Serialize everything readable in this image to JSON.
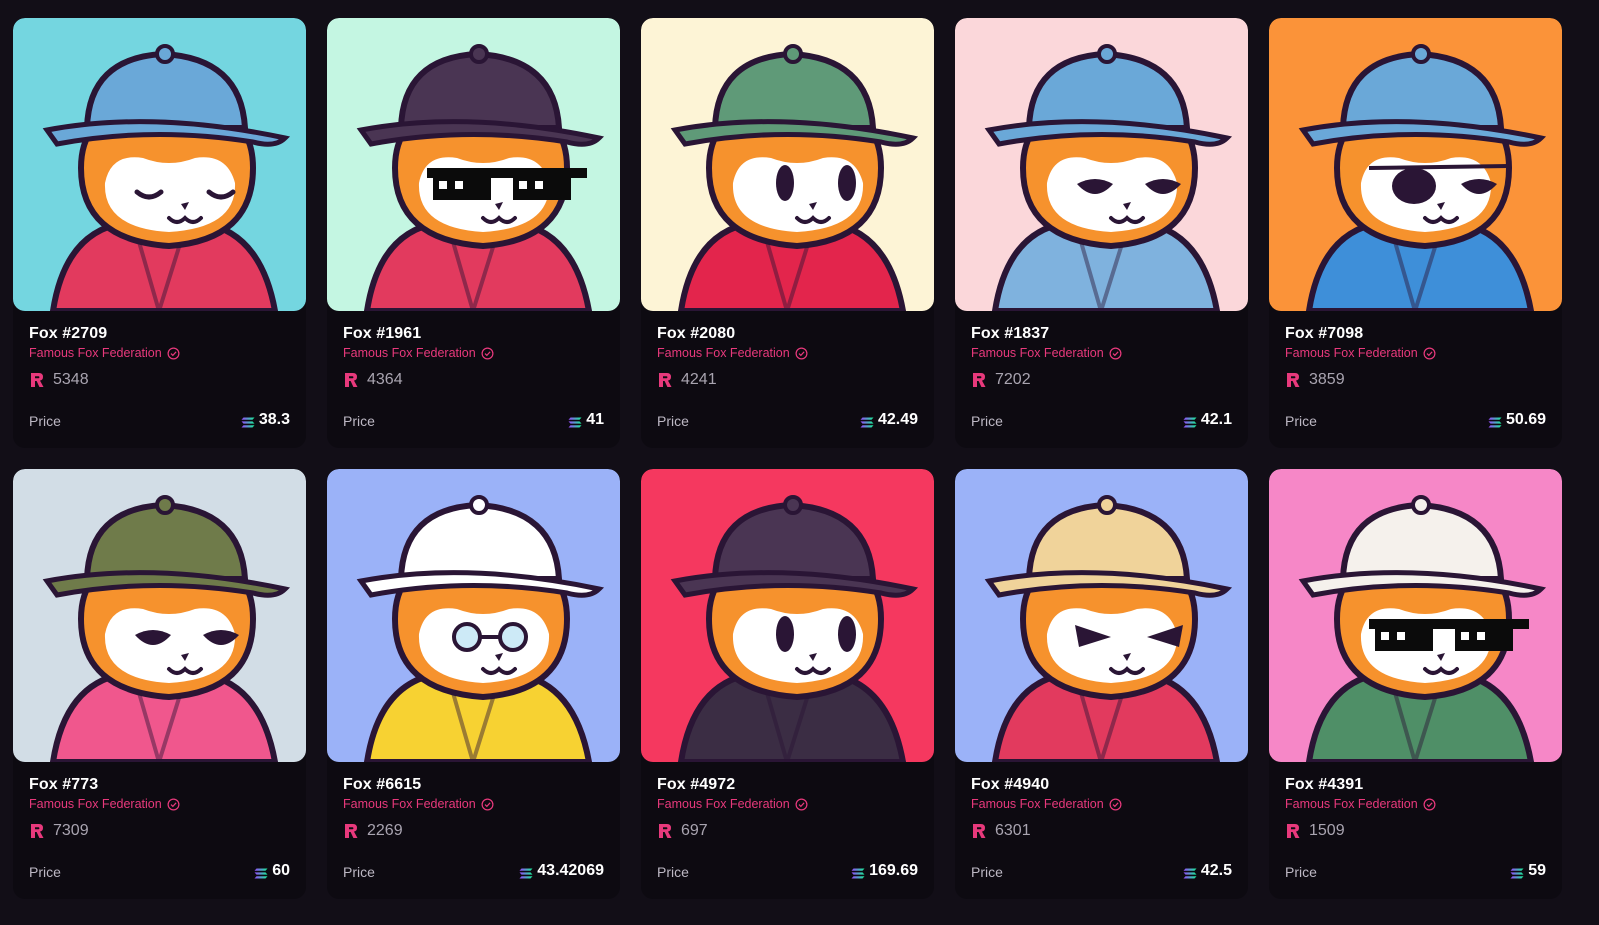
{
  "collection_name": "Famous Fox Federation",
  "price_label": "Price",
  "colors": {
    "page_bg": "#120e17",
    "card_bg": "#0d0a11",
    "collection_text": "#e8397c",
    "rank_icon": "#e8397c"
  },
  "icons": {
    "verified": "verified-badge-icon",
    "rank": "rank-r-icon",
    "currency": "solana-icon"
  },
  "cards": [
    {
      "title": "Fox #2709",
      "rank": "5348",
      "price": "38.3",
      "bg": "#74d6e0",
      "hat": "#6aa8d8",
      "outfit": "#e23a5e",
      "eyes": "closed"
    },
    {
      "title": "Fox #1961",
      "rank": "4364",
      "price": "41",
      "bg": "#c4f6e2",
      "hat": "#4a3553",
      "outfit": "#e23a5e",
      "eyes": "pixel"
    },
    {
      "title": "Fox #2080",
      "rank": "4241",
      "price": "42.49",
      "bg": "#fdf4d6",
      "hat": "#5f9a78",
      "outfit": "#e3254c",
      "eyes": "round"
    },
    {
      "title": "Fox #1837",
      "rank": "7202",
      "price": "42.1",
      "bg": "#fbd7da",
      "hat": "#6aa8d8",
      "outfit": "#7fb2de",
      "eyes": "half"
    },
    {
      "title": "Fox #7098",
      "rank": "3859",
      "price": "50.69",
      "bg": "#fb9339",
      "hat": "#6aa8d8",
      "outfit": "#3e8fd9",
      "eyes": "patch"
    },
    {
      "title": "Fox #773",
      "rank": "7309",
      "price": "60",
      "bg": "#d2dde6",
      "hat": "#6f7b4a",
      "outfit": "#f0578d",
      "eyes": "half"
    },
    {
      "title": "Fox #6615",
      "rank": "2269",
      "price": "43.42069",
      "bg": "#9bb2f8",
      "hat": "#ffffff",
      "outfit": "#f7d232",
      "eyes": "glasses"
    },
    {
      "title": "Fox #4972",
      "rank": "697",
      "price": "169.69",
      "bg": "#f5385f",
      "hat": "#4a3553",
      "outfit": "#3b2d44",
      "eyes": "round"
    },
    {
      "title": "Fox #4940",
      "rank": "6301",
      "price": "42.5",
      "bg": "#9bb2f8",
      "hat": "#f0d39a",
      "outfit": "#e23a5e",
      "eyes": "angry"
    },
    {
      "title": "Fox #4391",
      "rank": "1509",
      "price": "59",
      "bg": "#f687c7",
      "hat": "#f5f1ec",
      "outfit": "#4f8f67",
      "eyes": "pixel"
    }
  ]
}
